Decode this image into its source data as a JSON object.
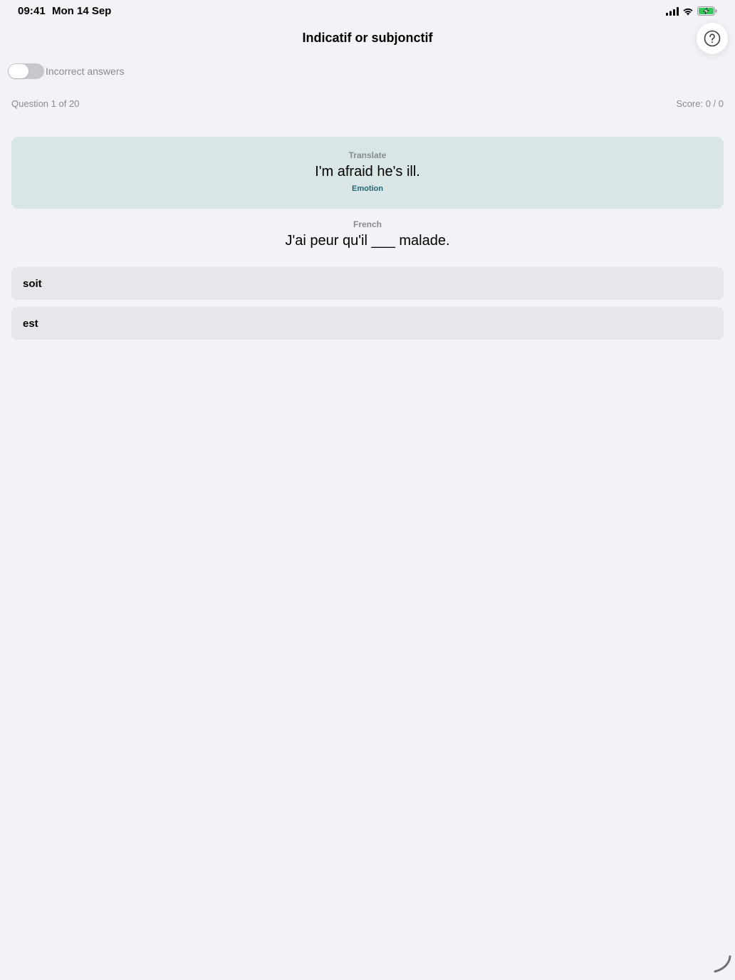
{
  "status_bar": {
    "time": "09:41",
    "date": "Mon 14 Sep",
    "icons": [
      "cellular-signal-icon",
      "wifi-icon",
      "battery-charging-icon"
    ],
    "battery_color": "#34c759"
  },
  "header": {
    "title": "Indicatif or subjonctif",
    "help_icon": "question-circle-icon"
  },
  "toggle": {
    "label": "Incorrect answers",
    "on": false
  },
  "progress": {
    "question_text": "Question 1 of 20",
    "score_text": "Score: 0 / 0"
  },
  "prompt": {
    "heading": "Translate",
    "sentence": "I'm afraid he's ill.",
    "category": "Emotion",
    "background_color": "#dae5e6",
    "category_color": "#1f6a74"
  },
  "target": {
    "heading": "French",
    "sentence": "J'ai peur qu'il ___ malade."
  },
  "options": [
    {
      "label": "soit"
    },
    {
      "label": "est"
    }
  ]
}
